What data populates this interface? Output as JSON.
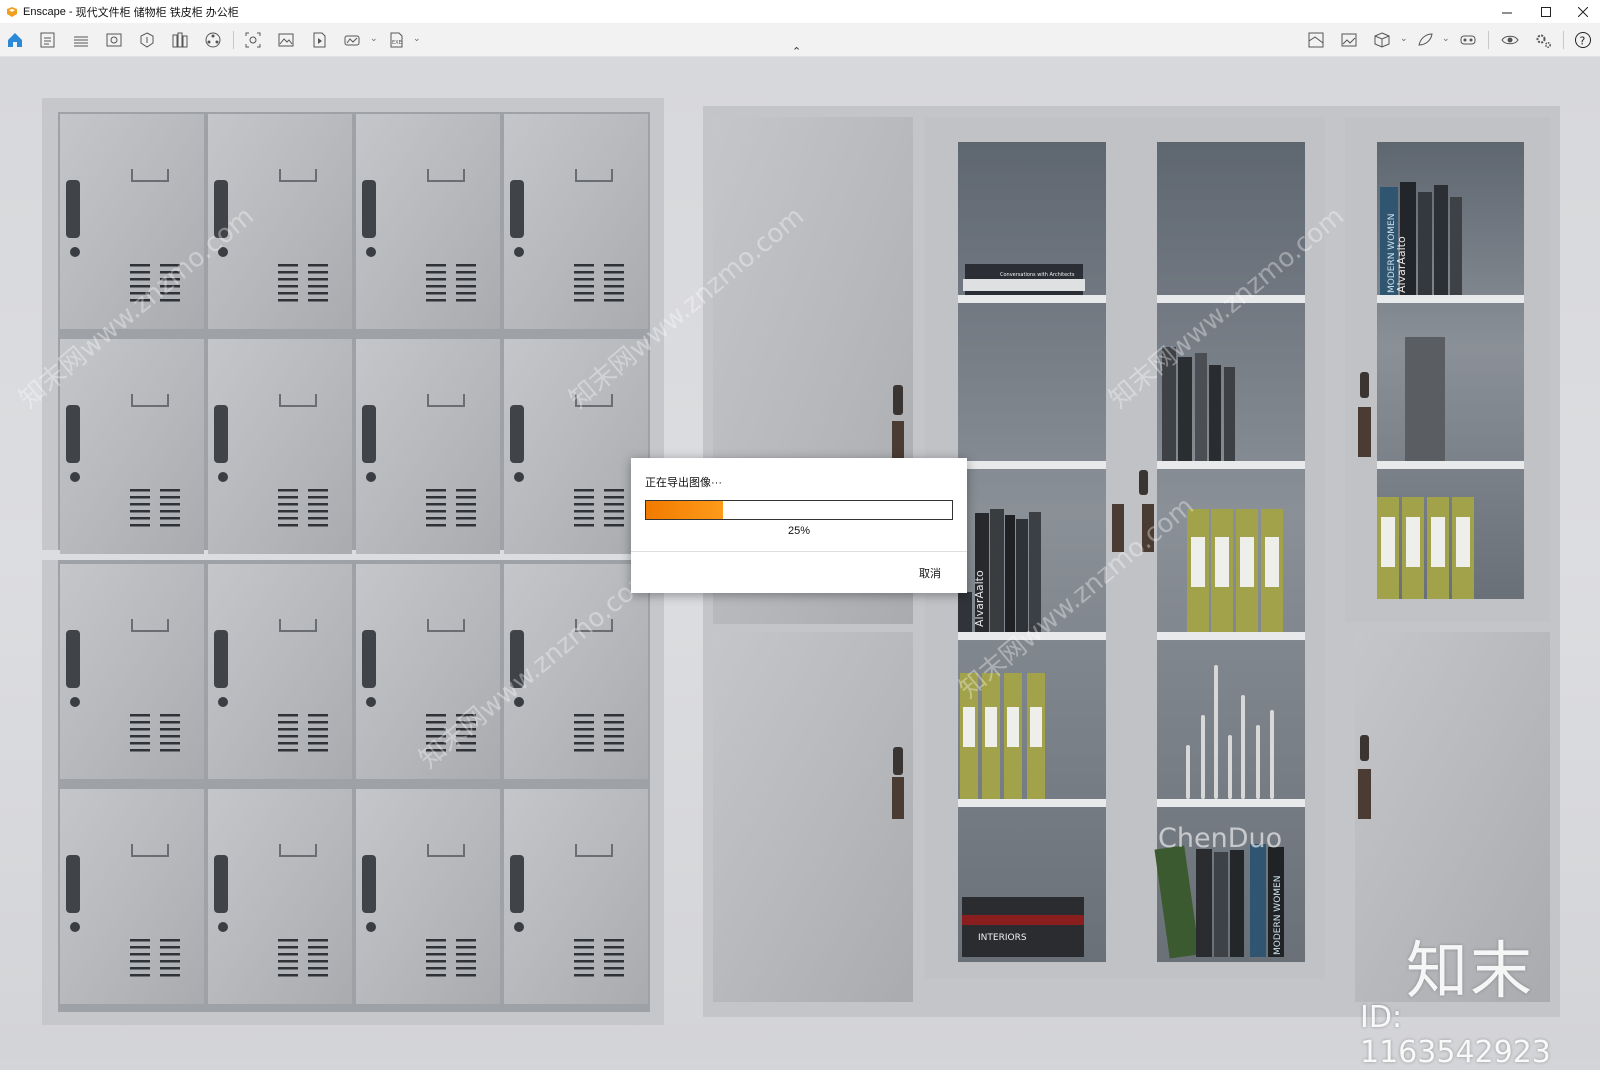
{
  "window": {
    "app_name": "Enscape",
    "separator": " - ",
    "document_title": "现代文件柜 储物柜 铁皮柜 办公柜",
    "accent_color": "#f0a020"
  },
  "toolbar": {
    "left_icons": [
      "home-icon",
      "project-icon",
      "bim-icon",
      "view-icon",
      "asset-icon",
      "library-icon",
      "settings-wheel-icon",
      "screenshot-icon",
      "image-export-icon",
      "video-export-icon",
      "panorama-icon",
      "exe-export-icon"
    ],
    "right_icons": [
      "map-icon",
      "image-icon",
      "cube-icon",
      "feedback-icon",
      "vr-headset-icon",
      "eye-icon",
      "gear-icon",
      "help-icon"
    ]
  },
  "dialog": {
    "title": "正在导出图像···",
    "progress_fraction": 0.25,
    "progress_text": "25%",
    "cancel_label": "取消",
    "progress_color": "#f07a00"
  },
  "scene": {
    "book_spine_1": "AlvarAalto",
    "book_spine_2": "MODERN WOMEN",
    "book_cover": "INTERIORS",
    "book_small": "Conversations with Architects",
    "watermark_text": "ChenDuo"
  },
  "watermark": {
    "brand": "知末",
    "id_text": "ID: 1163542923",
    "diagonal": "知末网www.znzmo.com"
  }
}
